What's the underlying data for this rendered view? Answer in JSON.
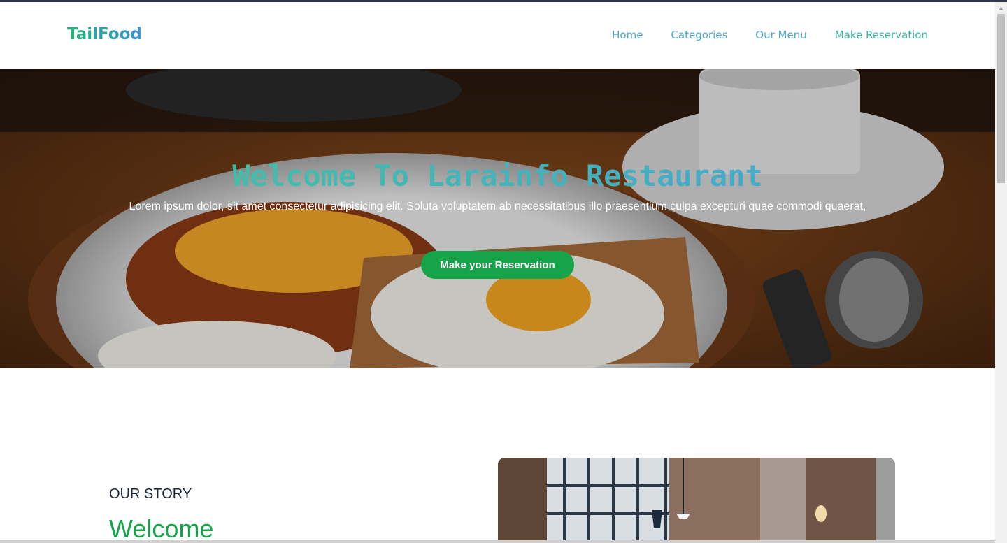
{
  "brand": "TailFood",
  "nav": {
    "links": [
      "Home",
      "Categories",
      "Our Menu",
      "Make Reservation"
    ]
  },
  "hero": {
    "title": "Welcome To Larainfo Restaurant",
    "subtitle": "Lorem ipsum dolor, sit amet consectetur adipisicing elit. Soluta voluptatem ab necessitatibus illo praesentium culpa excepturi quae commodi quaerat,",
    "button": "Make your Reservation"
  },
  "story": {
    "label": "OUR STORY",
    "title": "Welcome"
  },
  "colors": {
    "accent_green": "#16a34a",
    "link_teal": "#4fa8c9"
  }
}
